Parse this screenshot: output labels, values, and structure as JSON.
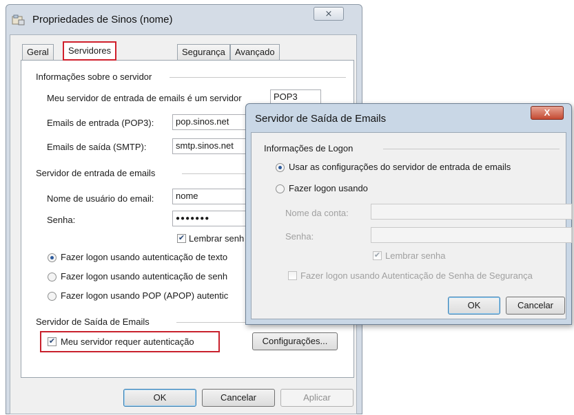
{
  "main_window": {
    "title": "Propriedades de Sinos (nome)",
    "close_glyph": "⨯",
    "tabs": [
      "Geral",
      "Servidores",
      "Segurança",
      "Avançado"
    ],
    "active_tab": "Servidores",
    "server_info": {
      "group_label": "Informações sobre o servidor",
      "incoming_type_label": "Meu servidor de entrada de emails é um servidor",
      "incoming_type_value": "POP3",
      "incoming_label": "Emails de entrada (POP3):",
      "incoming_value": "pop.sinos.net",
      "outgoing_label": "Emails de saída (SMTP):",
      "outgoing_value": "smtp.sinos.net"
    },
    "incoming_server": {
      "group_label": "Servidor de entrada de emails",
      "username_label": "Nome de usuário do email:",
      "username_value": "nome",
      "password_label": "Senha:",
      "password_value": "●●●●●●●",
      "remember_label": "Lembrar senh",
      "logon_options": [
        "Fazer logon usando autenticação de texto",
        "Fazer logon usando autenticação de senh",
        "Fazer logon usando POP (APOP) autentic"
      ]
    },
    "outgoing_server": {
      "group_label": "Servidor de Saída de Emails",
      "requires_auth_label": "Meu servidor requer autenticação",
      "settings_button": "Configurações..."
    },
    "buttons": {
      "ok": "OK",
      "cancel": "Cancelar",
      "apply": "Aplicar"
    }
  },
  "dialog": {
    "title": "Servidor de Saída de Emails",
    "close_glyph": "X",
    "group_label": "Informações de Logon",
    "option_use_incoming": "Usar as configurações do servidor de entrada de emails",
    "option_logon_using": "Fazer logon usando",
    "account_label": "Nome da conta:",
    "password_label": "Senha:",
    "remember_label": "Lembrar senha",
    "spa_label": "Fazer logon usando Autenticação de Senha de Segurança",
    "ok": "OK",
    "cancel": "Cancelar"
  },
  "colors": {
    "highlight": "#c8202c",
    "window_frame": "#d4dce6"
  }
}
